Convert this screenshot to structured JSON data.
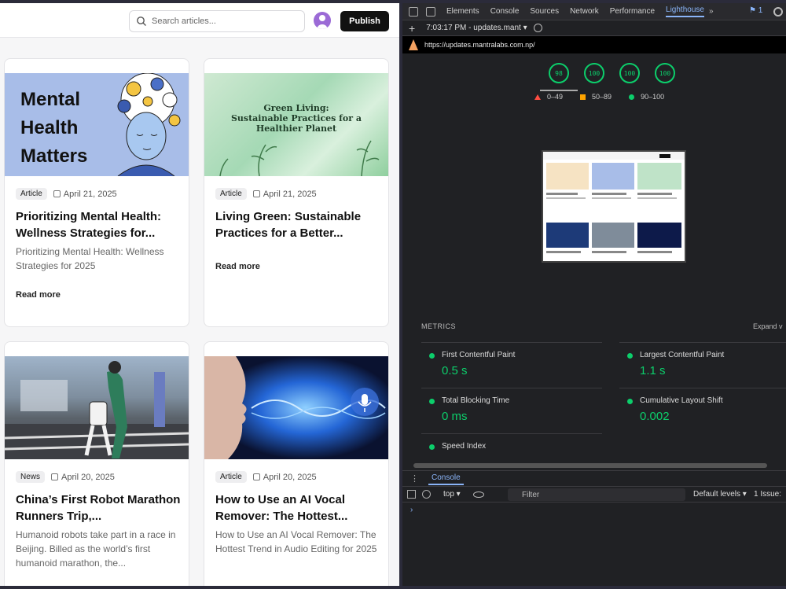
{
  "site": {
    "search_placeholder": "Search articles...",
    "publish_label": "Publish",
    "cards": [
      {
        "tag": "Article",
        "date": "April 21, 2025",
        "title": "Prioritizing Mental Health: Wellness Strategies for...",
        "excerpt": "Prioritizing Mental Health: Wellness Strategies for 2025",
        "read_more": "Read more",
        "image_text_1": "Mental",
        "image_text_2": "Health",
        "image_text_3": "Matters"
      },
      {
        "tag": "Article",
        "date": "April 21, 2025",
        "title": "Living Green: Sustainable Practices for a Better...",
        "excerpt": "",
        "read_more": "Read more",
        "image_text_1": "Green Living:",
        "image_text_2": "Sustainable Practices for a",
        "image_text_3": "Healthier Planet"
      },
      {
        "tag": "News",
        "date": "April 20, 2025",
        "title": "China’s First Robot Marathon Runners Trip,...",
        "excerpt": "Humanoid robots take part in a race in Beijing. Billed as the world’s first humanoid marathon, the..."
      },
      {
        "tag": "Article",
        "date": "April 20, 2025",
        "title": "How to Use an AI Vocal Remover: The Hottest...",
        "excerpt": "How to Use an AI Vocal Remover: The Hottest Trend in Audio Editing for 2025"
      }
    ]
  },
  "devtools": {
    "tabs": [
      "Elements",
      "Console",
      "Sources",
      "Network",
      "Performance",
      "Lighthouse"
    ],
    "more": "»",
    "issues_badge": "1",
    "report_label": "7:03:17 PM - updates.mant",
    "url": "https://updates.mantralabs.com.np/",
    "scores": [
      "98",
      "100",
      "100",
      "100"
    ],
    "legend": [
      "0–49",
      "50–89",
      "90–100"
    ],
    "metrics_title": "METRICS",
    "expand_label": "Expand v",
    "metrics": [
      {
        "name": "First Contentful Paint",
        "value": "0.5 s"
      },
      {
        "name": "Largest Contentful Paint",
        "value": "1.1 s"
      },
      {
        "name": "Total Blocking Time",
        "value": "0 ms"
      },
      {
        "name": "Cumulative Layout Shift",
        "value": "0.002"
      },
      {
        "name": "Speed Index",
        "value": ""
      }
    ],
    "console": {
      "tab_label": "Console",
      "context": "top ▾",
      "filter_placeholder": "Filter",
      "levels": "Default levels ▾",
      "issues": "1 Issue:",
      "prompt": "›"
    }
  },
  "colors": {
    "score_green": "#0cce6b",
    "fail_red": "#ff4e42",
    "average_orange": "#ffa400",
    "accent_blue": "#8ab4f8"
  }
}
